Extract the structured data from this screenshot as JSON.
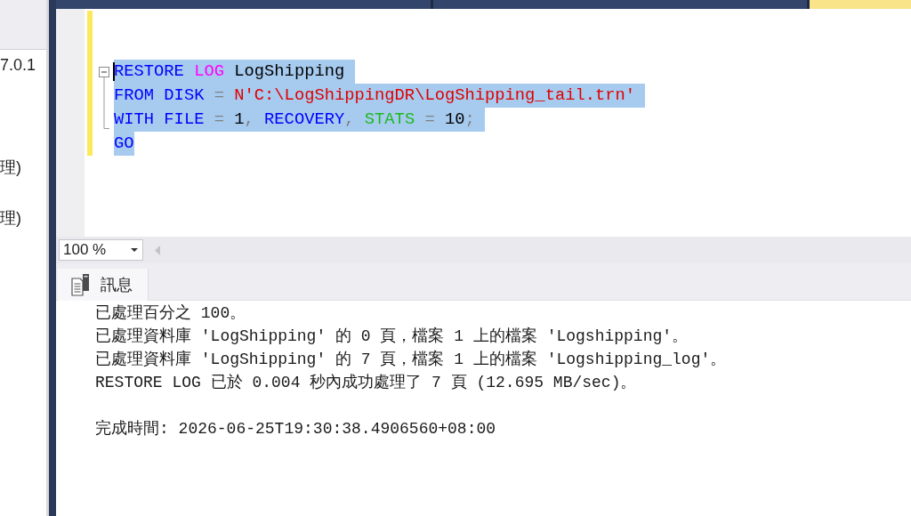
{
  "document_tabs": [
    {
      "selected": false
    },
    {
      "selected": false
    },
    {
      "selected": true
    }
  ],
  "object_explorer": {
    "server_node": "7.0.1",
    "nodes": [
      "理)",
      "理)"
    ]
  },
  "editor": {
    "lines": [
      {
        "selected": true,
        "tokens": [
          {
            "kind": "keyword",
            "text": "RESTORE"
          },
          {
            "kind": "function",
            "text": " LOG"
          },
          {
            "kind": "plain",
            "text": " LogShipping"
          }
        ]
      },
      {
        "selected": true,
        "tokens": [
          {
            "kind": "keyword",
            "text": "FROM DISK"
          },
          {
            "kind": "operator",
            "text": " ="
          },
          {
            "kind": "string",
            "text": " N'C:\\LogShippingDR\\LogShipping_tail.trn'"
          }
        ]
      },
      {
        "selected": true,
        "tokens": [
          {
            "kind": "keyword",
            "text": "WITH FILE"
          },
          {
            "kind": "operator",
            "text": " ="
          },
          {
            "kind": "plain",
            "text": " 1"
          },
          {
            "kind": "operator",
            "text": ","
          },
          {
            "kind": "keyword",
            "text": " RECOVERY"
          },
          {
            "kind": "operator",
            "text": ","
          },
          {
            "kind": "system",
            "text": " STATS"
          },
          {
            "kind": "operator",
            "text": " ="
          },
          {
            "kind": "plain",
            "text": " 10"
          },
          {
            "kind": "operator",
            "text": ";"
          }
        ]
      },
      {
        "selected": true,
        "tokens": [
          {
            "kind": "keyword",
            "text": "GO"
          }
        ]
      }
    ]
  },
  "zoom": {
    "value": "100 %"
  },
  "results_tabs": [
    {
      "label": "訊息",
      "selected": true
    }
  ],
  "messages": {
    "lines": [
      "已處理百分之 100。",
      "已處理資料庫 'LogShipping' 的 0 頁，檔案 1 上的檔案 'Logshipping'。",
      "已處理資料庫 'LogShipping' 的 7 頁，檔案 1 上的檔案 'Logshipping_log'。",
      "RESTORE LOG 已於 0.004 秒內成功處理了 7 頁 (12.695 MB/sec)。"
    ],
    "completion_time": "完成時間: 2026-06-25T19:30:38.4906560+08:00"
  }
}
